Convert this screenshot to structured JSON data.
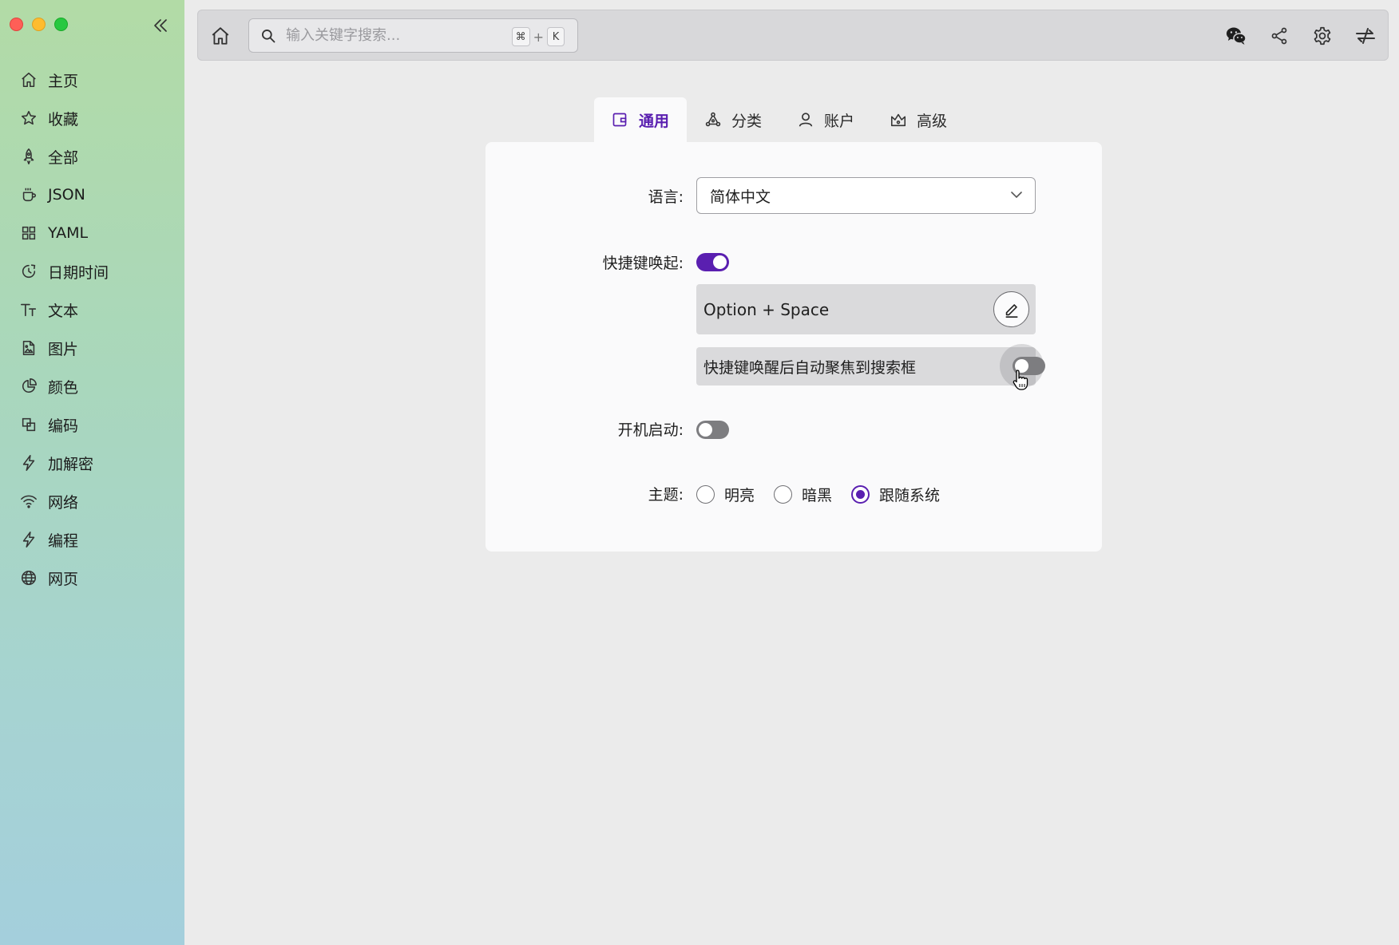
{
  "sidebar": {
    "items": [
      {
        "label": "主页",
        "icon": "home-icon"
      },
      {
        "label": "收藏",
        "icon": "star-icon"
      },
      {
        "label": "全部",
        "icon": "rocket-icon"
      },
      {
        "label": "JSON",
        "icon": "coffee-cup-icon"
      },
      {
        "label": "YAML",
        "icon": "grid-icon"
      },
      {
        "label": "日期时间",
        "icon": "clock-icon"
      },
      {
        "label": "文本",
        "icon": "text-size-icon"
      },
      {
        "label": "图片",
        "icon": "image-file-icon"
      },
      {
        "label": "颜色",
        "icon": "pie-chart-icon"
      },
      {
        "label": "编码",
        "icon": "copy-blocks-icon"
      },
      {
        "label": "加解密",
        "icon": "bolt-icon"
      },
      {
        "label": "网络",
        "icon": "wifi-icon"
      },
      {
        "label": "编程",
        "icon": "bolt-icon"
      },
      {
        "label": "网页",
        "icon": "globe-icon"
      }
    ]
  },
  "search": {
    "placeholder": "输入关键字搜索...",
    "shortcut_mod": "⌘",
    "shortcut_plus": "+",
    "shortcut_key": "K"
  },
  "tabs": [
    {
      "label": "通用",
      "icon": "wallet-icon",
      "active": true
    },
    {
      "label": "分类",
      "icon": "nodes-icon",
      "active": false
    },
    {
      "label": "账户",
      "icon": "user-icon",
      "active": false
    },
    {
      "label": "高级",
      "icon": "crown-icon",
      "active": false
    }
  ],
  "settings": {
    "language_label": "语言:",
    "language_value": "简体中文",
    "hotkey_label": "快捷键唤起:",
    "hotkey_enabled": true,
    "hotkey_combo": "Option + Space",
    "autofocus_label": "快捷键唤醒后自动聚焦到搜索框",
    "autofocus_enabled": false,
    "autostart_label": "开机启动:",
    "autostart_enabled": false,
    "theme_label": "主题:",
    "theme_options": [
      "明亮",
      "暗黑",
      "跟随系统"
    ],
    "theme_selected": "跟随系统"
  },
  "colors": {
    "accent": "#5a1fb0",
    "toggle_off": "#7d7d80"
  }
}
